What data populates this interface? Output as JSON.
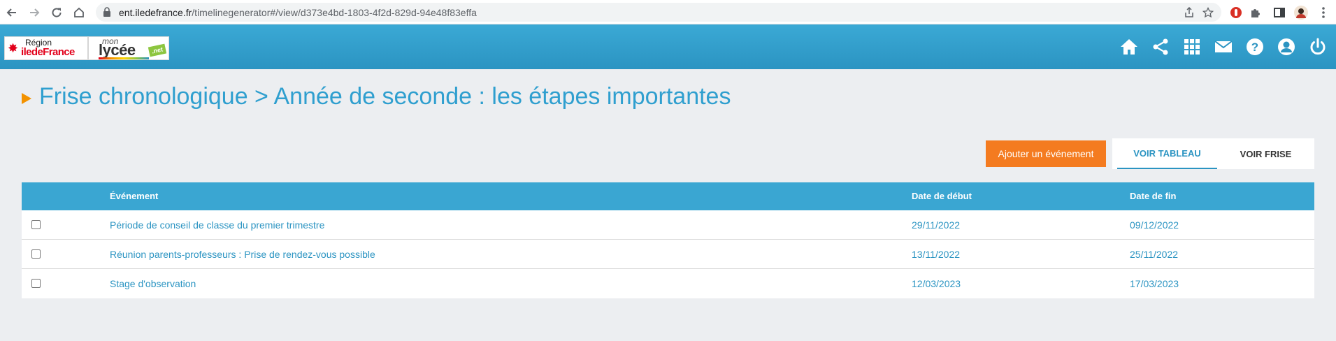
{
  "browser": {
    "url_host": "ent.iledefrance.fr",
    "url_path": "/timelinegenerator#/view/d373e4bd-1803-4f2d-829d-94e48f83effa"
  },
  "header": {
    "logo_region_top": "Région",
    "logo_region_bottom": "iledeFrance",
    "logo_lycee_mon": "mon",
    "logo_lycee_word": "lycée",
    "logo_lycee_net": ".net",
    "icons": [
      "home-icon",
      "share-icon",
      "apps-grid-icon",
      "mail-icon",
      "help-icon",
      "account-icon",
      "power-icon"
    ]
  },
  "page": {
    "title": "Frise chronologique > Année de seconde : les étapes importantes"
  },
  "actions": {
    "add_event": "Ajouter un événement",
    "view_table": "VOIR TABLEAU",
    "view_timeline": "VOIR FRISE",
    "active_view": "VOIR TABLEAU"
  },
  "table": {
    "columns": [
      "Événement",
      "Date de début",
      "Date de fin"
    ],
    "rows": [
      {
        "event": "Période de conseil de classe du premier trimestre",
        "start": "29/11/2022",
        "end": "09/12/2022",
        "checked": false
      },
      {
        "event": "Réunion parents-professeurs : Prise de rendez-vous possible",
        "start": "13/11/2022",
        "end": "25/11/2022",
        "checked": false
      },
      {
        "event": "Stage d'observation",
        "start": "12/03/2023",
        "end": "17/03/2023",
        "checked": false
      }
    ]
  },
  "colors": {
    "header_blue": "#2b94c2",
    "accent_orange": "#f47b20",
    "title_blue": "#2f9fcf"
  }
}
